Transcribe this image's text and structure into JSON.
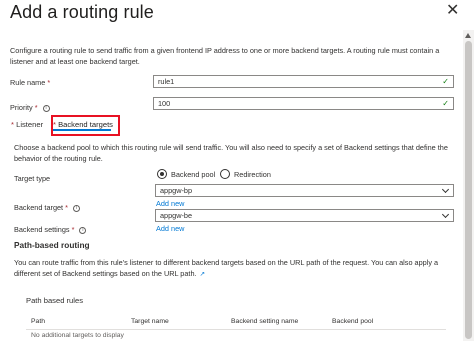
{
  "header": {
    "title": "Add a routing rule",
    "close_glyph": "✕"
  },
  "description": "Configure a routing rule to send traffic from a given frontend IP address to one or more backend targets. A routing rule must contain a listener and at least one backend target.",
  "form": {
    "rule_name": {
      "label": "Rule name",
      "required": "*",
      "value": "rule1"
    },
    "priority": {
      "label": "Priority",
      "required": "*",
      "value": "100"
    }
  },
  "tabs": [
    {
      "label": "Listener",
      "required": "*"
    },
    {
      "label": "Backend targets",
      "required": "*"
    }
  ],
  "backend": {
    "intro": "Choose a backend pool to which this routing rule will send traffic. You will also need to specify a set of Backend settings that define the behavior of the routing rule.",
    "target_type": {
      "label": "Target type",
      "options": [
        "Backend pool",
        "Redirection"
      ],
      "selected": "Backend pool"
    },
    "target_type_value": "appgw-bp",
    "backend_target": {
      "label": "Backend target",
      "required": "*",
      "add_new": "Add new"
    },
    "backend_settings": {
      "label": "Backend settings",
      "required": "*",
      "value": "appgw-be",
      "add_new": "Add new"
    }
  },
  "path_routing": {
    "title": "Path-based routing",
    "description": "You can route traffic from this rule's listener to different backend targets based on the URL path of the request. You can also apply a different set of Backend settings based on the URL path.",
    "table_title": "Path based rules",
    "columns": [
      "Path",
      "Target name",
      "Backend setting name",
      "Backend pool"
    ],
    "empty_text": "No additional targets to display"
  },
  "icons": {
    "info": "info-icon",
    "check": "checkmark-icon",
    "external": "external-link-icon"
  },
  "colors": {
    "accent": "#0078d4",
    "highlight_box": "#e81123",
    "required": "#a4262c",
    "valid": "#107c10"
  }
}
